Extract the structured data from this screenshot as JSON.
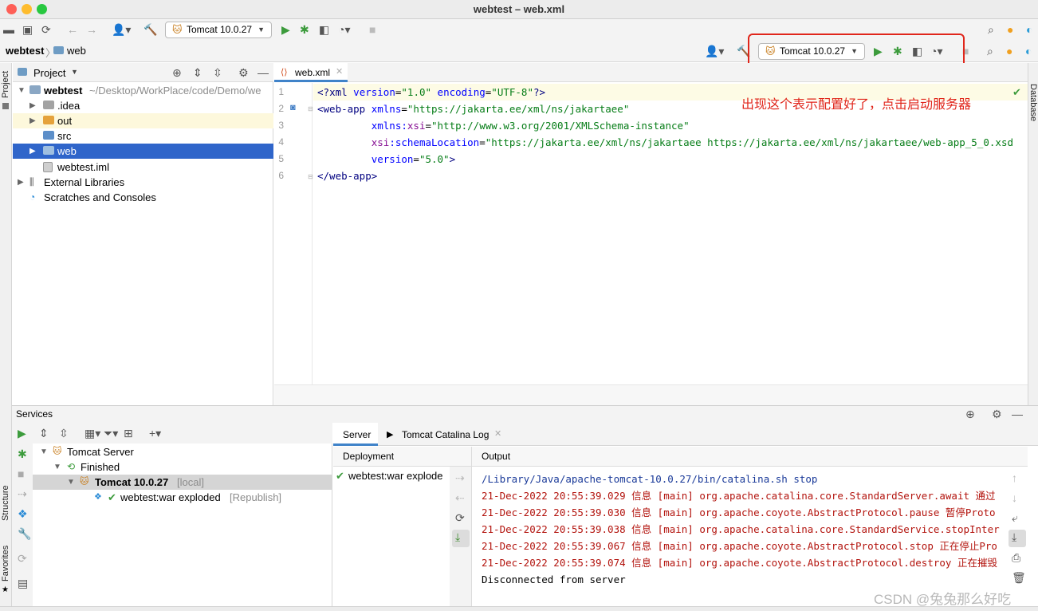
{
  "window": {
    "title": "webtest – web.xml"
  },
  "toolbar": {
    "run_config": "Tomcat 10.0.27"
  },
  "breadcrumb": {
    "project": "webtest",
    "folder": "web"
  },
  "highlight": {
    "run_config": "Tomcat 10.0.27",
    "annotation": "出现这个表示配置好了，点击启动服务器",
    "color": "#e0261b"
  },
  "side_tabs": {
    "project": "Project",
    "structure": "Structure",
    "favorites": "Favorites",
    "database": "Database"
  },
  "project_panel": {
    "header": "Project",
    "tree": [
      {
        "label": "webtest",
        "detail": "~/Desktop/WorkPlace/code/Demo/we"
      },
      {
        "label": ".idea"
      },
      {
        "label": "out"
      },
      {
        "label": "src"
      },
      {
        "label": "web"
      },
      {
        "label": "webtest.iml"
      },
      {
        "label": "External Libraries"
      },
      {
        "label": "Scratches and Consoles"
      }
    ]
  },
  "editor": {
    "tab": "web.xml",
    "line_numbers": [
      "1",
      "2",
      "3",
      "4",
      "5",
      "6"
    ],
    "lines": [
      {
        "a": "<?",
        "b": "xml ",
        "c": "version",
        "d": "=",
        "e": "\"1.0\"",
        "f": " encoding",
        "g": "=",
        "h": "\"UTF-8\"",
        "i": "?>"
      },
      {
        "a": "<web-app ",
        "c": "xmlns",
        "d": "=",
        "e": "\"https://jakarta.ee/xml/ns/jakartaee\""
      },
      {
        "c": "xmlns:",
        "n": "xsi",
        "d": "=",
        "e": "\"http://www.w3.org/2001/XMLSchema-instance\""
      },
      {
        "n": "xsi",
        "c": ":schemaLocation",
        "d": "=",
        "e": "\"https://jakarta.ee/xml/ns/jakartaee https://jakarta.ee/xml/ns/jakartaee/web-app_5_0.xsd"
      },
      {
        "c": "version",
        "d": "=",
        "e": "\"5.0\"",
        "i": ">"
      },
      {
        "a": "</web-app>"
      }
    ]
  },
  "services": {
    "header": "Services",
    "tree": [
      {
        "label": "Tomcat Server"
      },
      {
        "label": "Finished"
      },
      {
        "label": "Tomcat 10.0.27",
        "detail": "[local]"
      },
      {
        "label": "webtest:war exploded",
        "detail": "[Republish]"
      }
    ],
    "tabs": [
      "Server",
      "Tomcat Catalina Log"
    ],
    "deployment_header": "Deployment",
    "output_header": "Output",
    "deployment_item": "webtest:war explode",
    "output_lines": [
      "/Library/Java/apache-tomcat-10.0.27/bin/catalina.sh stop",
      "21-Dec-2022 20:55:39.029 信息 [main] org.apache.catalina.core.StandardServer.await 通过",
      "21-Dec-2022 20:55:39.030 信息 [main] org.apache.coyote.AbstractProtocol.pause 暂停Proto",
      "21-Dec-2022 20:55:39.038 信息 [main] org.apache.catalina.core.StandardService.stopInter",
      "21-Dec-2022 20:55:39.067 信息 [main] org.apache.coyote.AbstractProtocol.stop 正在停止Pro",
      "21-Dec-2022 20:55:39.074 信息 [main] org.apache.coyote.AbstractProtocol.destroy 正在摧毁",
      "Disconnected from server"
    ]
  },
  "watermark": "CSDN @兔兔那么好吃"
}
